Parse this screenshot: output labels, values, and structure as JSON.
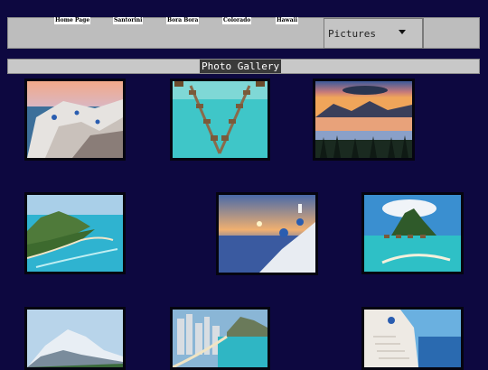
{
  "nav": {
    "links": [
      "Home Page",
      "Santorini",
      "Bora Bora",
      "Colorado",
      "Hawaii"
    ],
    "select_value": "Pictures"
  },
  "gallery": {
    "title": "Photo Gallery",
    "photos": [
      "santorini-village",
      "overwater-bungalows",
      "mountain-lake-sunset",
      "hawaii-coastline",
      "santorini-sunset",
      "bora-bora-mountain",
      "snowy-mountain",
      "waikiki-beach",
      "santorini-stairs"
    ]
  },
  "colors": {
    "background": "#0d0840",
    "bar": "#bdbdbd"
  }
}
